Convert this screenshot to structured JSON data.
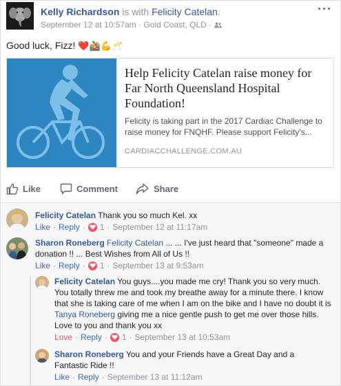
{
  "header": {
    "author": "Kelly Richardson",
    "with_text": "is with",
    "tagged": "Felicity Catelan",
    "period": ".",
    "date": "September 12 at 10:57am",
    "dot": "·",
    "location": "Gold Coast, QLD",
    "dot2": "·",
    "more": "···"
  },
  "post": {
    "text": "Good luck, Fizz!",
    "emoji": "❤️🚵💪🥂"
  },
  "preview": {
    "title": "Help Felicity Catelan raise money for Far North Queensland Hospital Foundation!",
    "description": "Felicity is taking part in the 2017 Cardiac Challenge to raise money for FNQHF. Please support Felicity's...",
    "domain": "CARDIACCHALLENGE.COM.AU"
  },
  "actions": {
    "like": "Like",
    "comment": "Comment",
    "share": "Share"
  },
  "comments": [
    {
      "name": "Felicity Catelan",
      "text": "Thank you so much Kel. xx",
      "like": "Like",
      "reply": "Reply",
      "reactions": "1",
      "time": "September 12 at 11:17am"
    },
    {
      "name": "Sharon Roneberg",
      "tag": "Felicity Catelan",
      "text": "... ... I've just heard that \"someone\" made a donation !! ... Best Wishes from All of Us !!",
      "like": "Like",
      "reply": "Reply",
      "reactions": "1",
      "time": "September 13 at 9:53am"
    }
  ],
  "replies": [
    {
      "name": "Felicity Catelan",
      "text1": "You guys....you made me cry! Thank you so very much. You totally threw me and took my breathe away for a minute there. I know that she is taking care of me when I am on the bike and I have no doubt it is",
      "tag": "Tanya Roneberg",
      "text2": "giving me a nice gentle push to get me over those hills. Love to you and thank you xx",
      "like": "Love",
      "reply": "Reply",
      "reactions": "1",
      "time": "September 13 at 10:53am"
    },
    {
      "name": "Sharon Roneberg",
      "text": "You and your Friends have a Great Day and a Fantastic Ride !!",
      "like": "Like",
      "reply": "Reply",
      "time": "September 13 at 11:12am"
    }
  ],
  "separator": "·",
  "colors": {
    "link": "#365899",
    "action": "#4267b2",
    "love": "#f25268",
    "meta": "#90949c",
    "preview_bg": "#2e86c1"
  }
}
